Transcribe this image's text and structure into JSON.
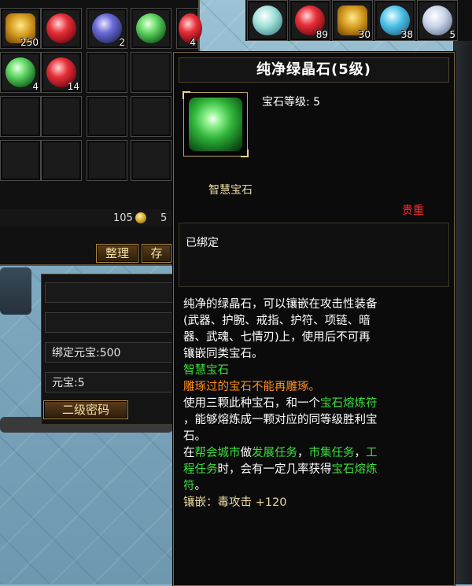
{
  "inventory": {
    "slots_row1": [
      {
        "item": "gold-ingot-icon",
        "count": "250"
      },
      {
        "item": "red-gem-icon",
        "count": ""
      },
      {
        "item": "blue-gem-icon",
        "count": "2"
      },
      {
        "item": "green-gem-icon",
        "count": ""
      },
      {
        "item": "red-gem-icon",
        "count": "4"
      }
    ],
    "slots_row2": [
      {
        "item": "green-gem-icon",
        "count": "4"
      },
      {
        "item": "red-gem-icon",
        "count": "14"
      }
    ],
    "money_value": "105",
    "money_value_2": "5",
    "sort_button": "整理",
    "store_button": "存"
  },
  "top_strip": {
    "slots": [
      {
        "item": "pearl-icon",
        "count": ""
      },
      {
        "item": "red-pouch-icon",
        "count": "89"
      },
      {
        "item": "gold-pot-icon",
        "count": "30"
      },
      {
        "item": "blue-bottle-icon",
        "count": "38"
      },
      {
        "item": "white-vial-icon",
        "count": "5"
      }
    ]
  },
  "wallet": {
    "bound_yuanbao": "绑定元宝:500",
    "yuanbao": "元宝:5",
    "password_button": "二级密码"
  },
  "tooltip": {
    "title": "纯净绿晶石(5级)",
    "gem_level_label": "宝石等级: 5",
    "gem_type": "智慧宝石",
    "rarity": "贵重",
    "bound_status": "已绑定",
    "desc_line1": "纯净的绿晶石，可以镶嵌在攻击性装备",
    "desc_line2": "(武器、护腕、戒指、护符、项链、暗",
    "desc_line3": "器、武魂、七情刃)上，使用后不可再",
    "desc_line4": "镶嵌同类宝石。",
    "wisdom_gem": "智慧宝石",
    "no_recarve": "雕琢过的宝石不能再雕琢。",
    "use_a": "使用三颗此种宝石，和一个",
    "use_b": "宝石熔炼符",
    "use_c": "，能够熔炼成一颗对应的同等级胜利宝",
    "use_d": "石。",
    "src_a": "在",
    "src_b": "帮会城市",
    "src_c": "做",
    "src_d": "发展任务",
    "src_e": "，",
    "src_f": "市集任务",
    "src_g": "，",
    "src_h": "工",
    "src_i": "程任务",
    "src_j": "时，会有一定几率获得",
    "src_k": "宝石熔炼",
    "src_l": "符",
    "src_m": "。",
    "inlay": "镶嵌：毒攻击 +120"
  },
  "colors": {
    "green_text": "#39e03d",
    "orange_text": "#ff8c1a",
    "rarity_red": "#ff3030",
    "border_gold": "#7a6a4a"
  }
}
